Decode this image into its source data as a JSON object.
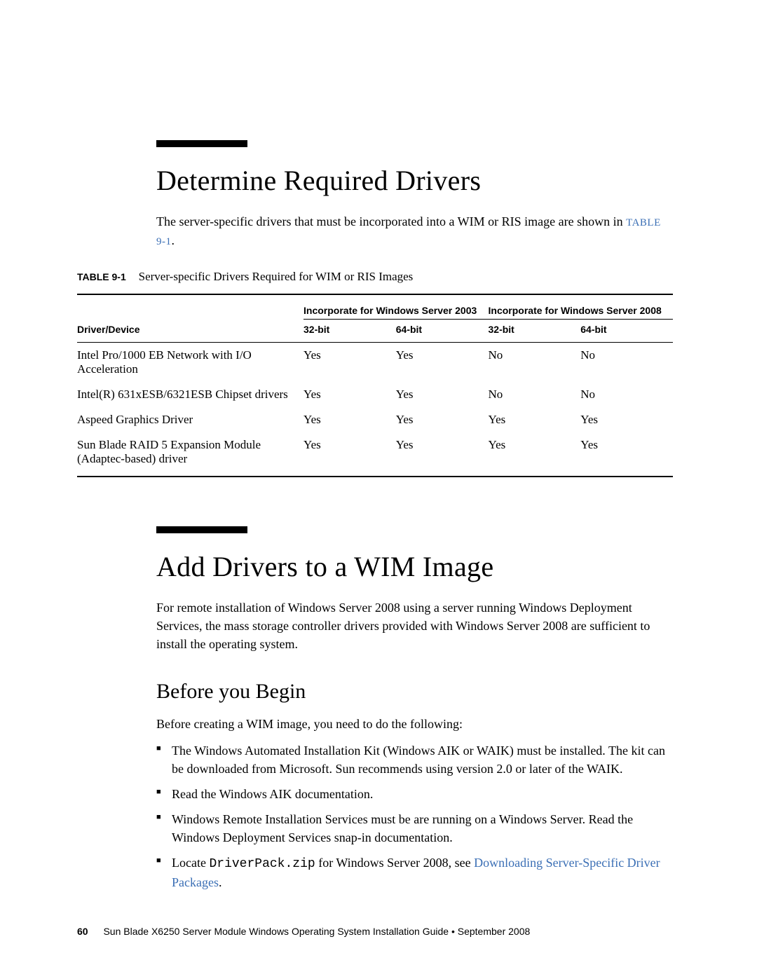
{
  "section1": {
    "heading": "Determine Required Drivers",
    "intro_pre": "The server-specific drivers that must be incorporated into a WIM or RIS image are shown in ",
    "intro_link": "TABLE 9-1",
    "intro_post": ".",
    "table_caption_code": "TABLE 9-1",
    "table_caption_desc": "Server-specific Drivers Required for WIM or RIS Images",
    "table": {
      "group1": "Incorporate for Windows Server 2003",
      "group2": "Incorporate for Windows Server 2008",
      "col_device": "Driver/Device",
      "col_32": "32-bit",
      "col_64": "64-bit",
      "rows": [
        {
          "device": "Intel Pro/1000 EB Network with I/O Acceleration",
          "a32": "Yes",
          "a64": "Yes",
          "b32": "No",
          "b64": "No"
        },
        {
          "device": "Intel(R) 631xESB/6321ESB Chipset drivers",
          "a32": "Yes",
          "a64": "Yes",
          "b32": "No",
          "b64": "No"
        },
        {
          "device": "Aspeed Graphics Driver",
          "a32": "Yes",
          "a64": "Yes",
          "b32": "Yes",
          "b64": "Yes"
        },
        {
          "device": "Sun Blade RAID 5 Expansion Module (Adaptec-based) driver",
          "a32": "Yes",
          "a64": "Yes",
          "b32": "Yes",
          "b64": "Yes"
        }
      ]
    }
  },
  "section2": {
    "heading": "Add Drivers to a WIM Image",
    "intro": "For remote installation of Windows Server 2008 using a server running Windows Deployment Services, the mass storage controller drivers provided with Windows Server 2008 are sufficient to install the operating system.",
    "sub_heading": "Before you Begin",
    "sub_intro": "Before creating a WIM image, you need to do the following:",
    "bullets": {
      "b1": "The Windows Automated Installation Kit (Windows AIK or WAIK) must be installed. The kit can be downloaded from Microsoft. Sun recommends using version 2.0 or later of the WAIK.",
      "b2": "Read the Windows AIK documentation.",
      "b3": "Windows Remote Installation Services must be are running on a Windows Server. Read the Windows Deployment Services snap-in documentation.",
      "b4_pre": "Locate ",
      "b4_code": "DriverPack.zip",
      "b4_mid": " for Windows Server 2008, see ",
      "b4_link": "Downloading Server-Specific Driver Packages",
      "b4_post": "."
    }
  },
  "footer": {
    "page": "60",
    "title": "Sun Blade X6250 Server Module Windows Operating System Installation Guide  •  September 2008"
  }
}
